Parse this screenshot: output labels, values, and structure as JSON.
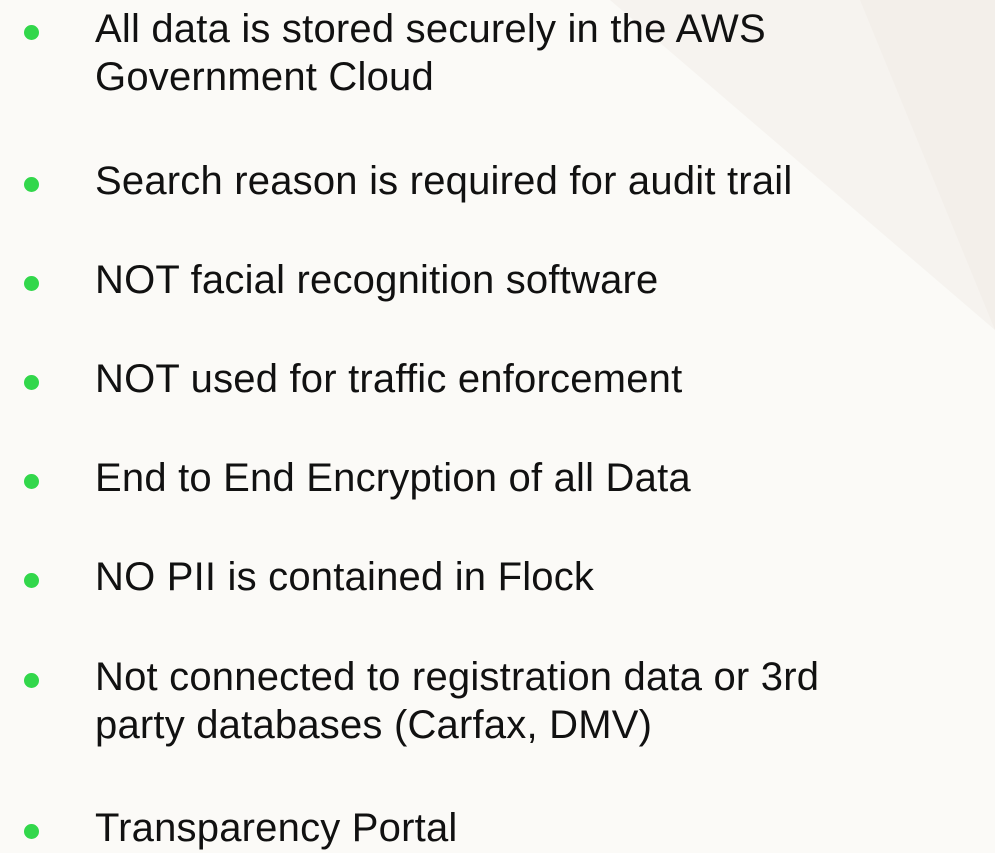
{
  "slide": {
    "accent_color": "#32d74b",
    "text_color": "#111111",
    "background_color": "#fbfaf7",
    "bullet_icon": "bullet-dot-icon",
    "bullets": [
      {
        "line1": "All data is stored securely in the AWS",
        "line2": "Government Cloud"
      },
      {
        "line1": "Search reason is required for audit trail",
        "line2": ""
      },
      {
        "line1": "NOT facial recognition software",
        "line2": ""
      },
      {
        "line1": "NOT used for traffic enforcement",
        "line2": ""
      },
      {
        "line1": "End to End Encryption of all Data",
        "line2": ""
      },
      {
        "line1": "NO PII is contained in Flock",
        "line2": ""
      },
      {
        "line1": "Not connected to registration data or 3rd",
        "line2": "party databases (Carfax, DMV)"
      },
      {
        "line1": "Transparency Portal",
        "line2": ""
      }
    ]
  }
}
